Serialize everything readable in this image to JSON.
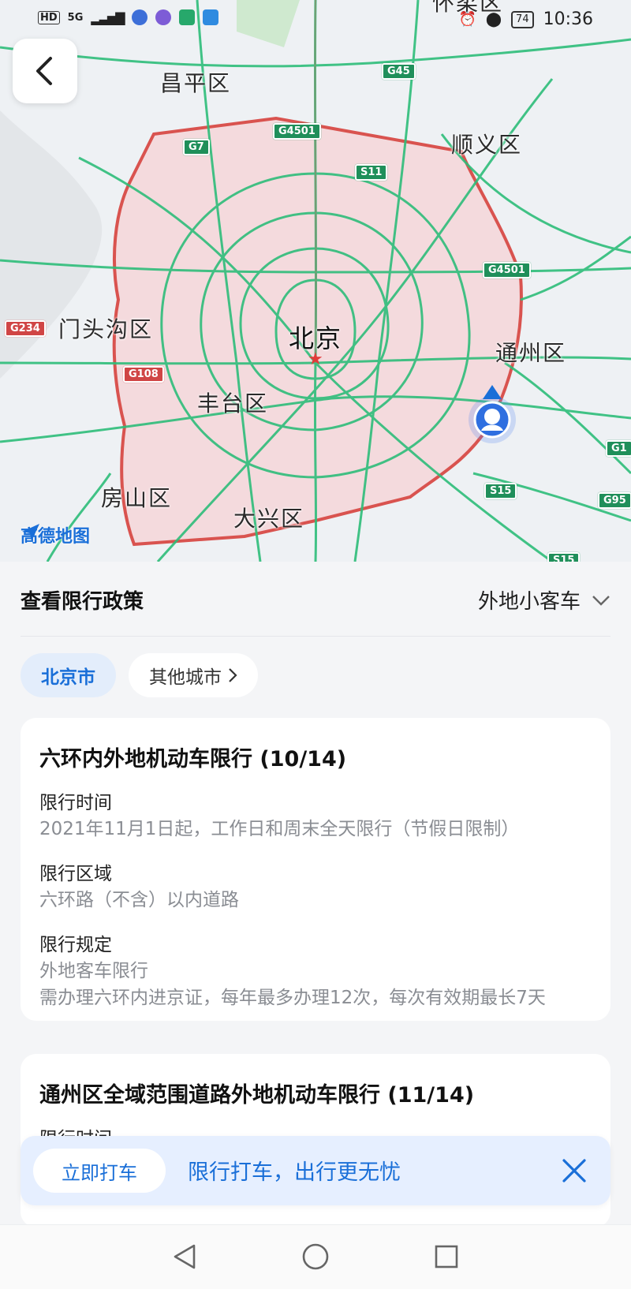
{
  "status_bar": {
    "left_labels": [
      "HD",
      "5G"
    ],
    "battery": "74",
    "time": "10:36"
  },
  "map": {
    "districts": [
      "昌平区",
      "顺义区",
      "门头沟区",
      "北京",
      "通州区",
      "丰台区",
      "房山区",
      "大兴区"
    ],
    "road_shields": [
      "G45",
      "G4501",
      "G7",
      "S11",
      "G4501",
      "G234",
      "G108",
      "G1",
      "S15",
      "G95",
      "S15"
    ],
    "top_partial_label": "怀柔区",
    "logo_text": "高德地图",
    "colors": {
      "road": "#2ebd7a",
      "ring": "#d9534f",
      "zone_fill": "#f6d2d6",
      "brand": "#1a6fd8"
    }
  },
  "panel": {
    "title": "查看限行政策",
    "vehicle_type": "外地小客车",
    "city_tabs": [
      "北京市",
      "其他城市"
    ],
    "rules": [
      {
        "title": "六环内外地机动车限行 (10/14)",
        "fields": [
          {
            "label": "限行时间",
            "value": "2021年11月1日起，工作日和周末全天限行（节假日限制）"
          },
          {
            "label": "限行区域",
            "value": "六环路（不含）以内道路"
          },
          {
            "label": "限行规定",
            "value": "外地客车限行",
            "value2": "需办理六环内进京证，每年最多办理12次，每次有效期最长7天"
          }
        ]
      },
      {
        "title": "通州区全域范围道路外地机动车限行 (11/14)",
        "fields": [
          {
            "label": "限行时间"
          }
        ]
      }
    ]
  },
  "banner": {
    "button": "立即打车",
    "text": "限行打车，出行更无忧"
  }
}
